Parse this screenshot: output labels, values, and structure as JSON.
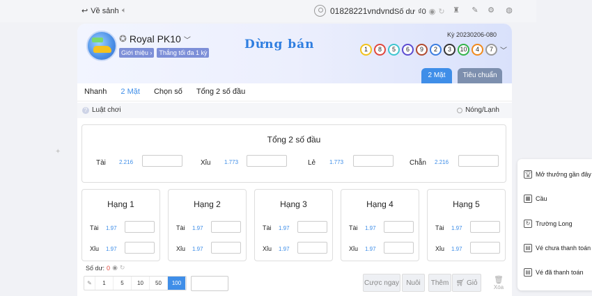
{
  "topbar": {
    "back_label": "Về sảnh",
    "username": "01828221vndvnd",
    "balance_label": "Số dư",
    "balance_value": "₫0"
  },
  "game": {
    "name": "Royal PK10",
    "tags": [
      "Giới thiệu",
      "Thắng tối đa 1 kỳ"
    ],
    "status": "Dừng bán",
    "period": "Kỳ 20230206-080",
    "results": [
      {
        "n": "1",
        "color": "#f2c21b"
      },
      {
        "n": "8",
        "color": "#e0463c"
      },
      {
        "n": "5",
        "color": "#3ec6d0"
      },
      {
        "n": "6",
        "color": "#5b4bd1"
      },
      {
        "n": "9",
        "color": "#b04a2f"
      },
      {
        "n": "2",
        "color": "#3b7de0"
      },
      {
        "n": "3",
        "color": "#333333"
      },
      {
        "n": "10",
        "color": "#32b24a"
      },
      {
        "n": "4",
        "color": "#f08a1c"
      },
      {
        "n": "7",
        "color": "#999999"
      }
    ],
    "modes": [
      "2 Mặt",
      "Tiêu chuẩn"
    ]
  },
  "subtabs": [
    "Nhanh",
    "2 Mặt",
    "Chọn số",
    "Tổng 2 số đầu"
  ],
  "rules_label": "Luật chơi",
  "hotcold_label": "Nóng/Lạnh",
  "sum": {
    "title": "Tổng 2 số đầu",
    "options": [
      {
        "label": "Tài",
        "odds": "2.216"
      },
      {
        "label": "Xỉu",
        "odds": "1.773"
      },
      {
        "label": "Lẻ",
        "odds": "1.773"
      },
      {
        "label": "Chẵn",
        "odds": "2.216"
      }
    ]
  },
  "ranks": [
    {
      "title": "Hạng 1",
      "rows": [
        {
          "label": "Tài",
          "odds": "1.97"
        },
        {
          "label": "Xỉu",
          "odds": "1.97"
        }
      ]
    },
    {
      "title": "Hạng 2",
      "rows": [
        {
          "label": "Tài",
          "odds": "1.97"
        },
        {
          "label": "Xỉu",
          "odds": "1.97"
        }
      ]
    },
    {
      "title": "Hạng 3",
      "rows": [
        {
          "label": "Tài",
          "odds": "1.97"
        },
        {
          "label": "Xỉu",
          "odds": "1.97"
        }
      ]
    },
    {
      "title": "Hạng 4",
      "rows": [
        {
          "label": "Tài",
          "odds": "1.97"
        },
        {
          "label": "Xỉu",
          "odds": "1.97"
        }
      ]
    },
    {
      "title": "Hạng 5",
      "rows": [
        {
          "label": "Tài",
          "odds": "1.97"
        },
        {
          "label": "Xỉu",
          "odds": "1.97"
        }
      ]
    }
  ],
  "bottom": {
    "balance_label": "Số dư:",
    "balance_value": "0",
    "chips": [
      "1",
      "5",
      "10",
      "50",
      "100"
    ],
    "active_chip": "100",
    "bet_now": "Cược ngay",
    "chase": "Nuôi số",
    "add": "Thêm",
    "cart": "Giỏ",
    "delete": "Xóa"
  },
  "right_menu": [
    {
      "icon": "trophy-icon",
      "label": "Mở thưởng gần đây"
    },
    {
      "icon": "grid-icon",
      "label": "Cầu"
    },
    {
      "icon": "refresh-icon",
      "label": "Trường Long"
    },
    {
      "icon": "ticket-unpaid-icon",
      "label": "Vé chưa thanh toán"
    },
    {
      "icon": "ticket-paid-icon",
      "label": "Vé đã thanh toán"
    }
  ]
}
